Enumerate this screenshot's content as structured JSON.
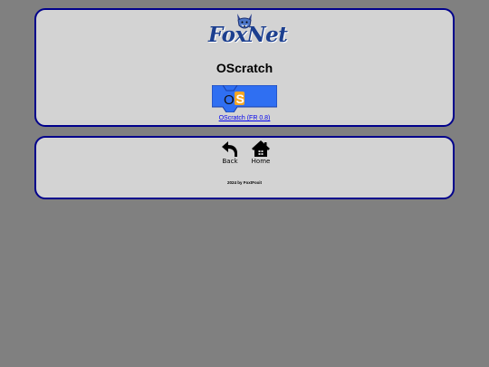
{
  "header": {
    "logo_text": "FoxNet"
  },
  "main": {
    "title": "OScratch",
    "project": {
      "thumbnail_text": "OS",
      "link_text": "OScratch (FR 0.8)"
    }
  },
  "nav": {
    "back_label": "Back",
    "home_label": "Home"
  },
  "footer": {
    "text": "2024 by FoxtFoxit"
  },
  "colors": {
    "page_background": "#808080",
    "card_background": "#d3d3d3",
    "card_border": "#00008b",
    "logo_blue": "#1c3f8f",
    "link": "#0000ee",
    "thumb_blue": "#2f6ff2"
  },
  "icons": {
    "logo": "fox-head-icon",
    "back": "back-arrow-icon",
    "home": "house-icon"
  }
}
